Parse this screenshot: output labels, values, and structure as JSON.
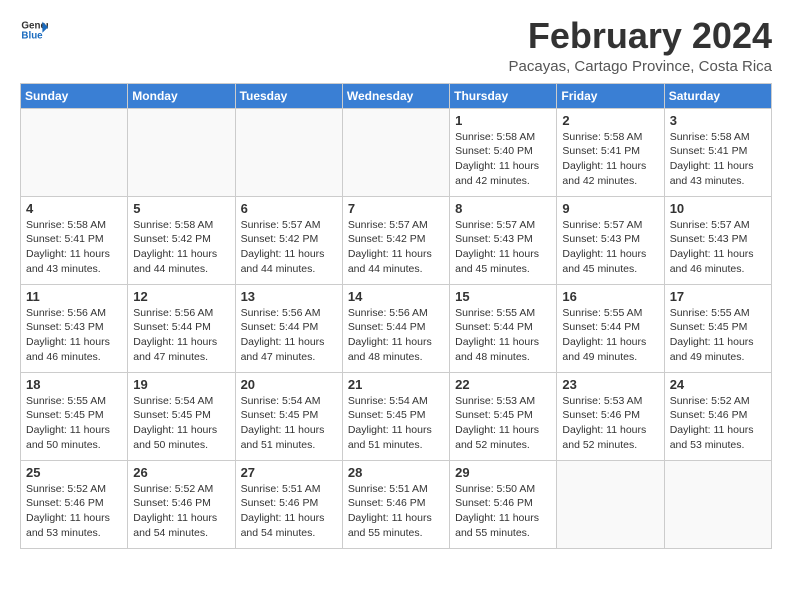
{
  "header": {
    "logo_line1": "General",
    "logo_line2": "Blue",
    "month_title": "February 2024",
    "subtitle": "Pacayas, Cartago Province, Costa Rica"
  },
  "days_of_week": [
    "Sunday",
    "Monday",
    "Tuesday",
    "Wednesday",
    "Thursday",
    "Friday",
    "Saturday"
  ],
  "weeks": [
    [
      {
        "day": "",
        "info": ""
      },
      {
        "day": "",
        "info": ""
      },
      {
        "day": "",
        "info": ""
      },
      {
        "day": "",
        "info": ""
      },
      {
        "day": "1",
        "info": "Sunrise: 5:58 AM\nSunset: 5:40 PM\nDaylight: 11 hours\nand 42 minutes."
      },
      {
        "day": "2",
        "info": "Sunrise: 5:58 AM\nSunset: 5:41 PM\nDaylight: 11 hours\nand 42 minutes."
      },
      {
        "day": "3",
        "info": "Sunrise: 5:58 AM\nSunset: 5:41 PM\nDaylight: 11 hours\nand 43 minutes."
      }
    ],
    [
      {
        "day": "4",
        "info": "Sunrise: 5:58 AM\nSunset: 5:41 PM\nDaylight: 11 hours\nand 43 minutes."
      },
      {
        "day": "5",
        "info": "Sunrise: 5:58 AM\nSunset: 5:42 PM\nDaylight: 11 hours\nand 44 minutes."
      },
      {
        "day": "6",
        "info": "Sunrise: 5:57 AM\nSunset: 5:42 PM\nDaylight: 11 hours\nand 44 minutes."
      },
      {
        "day": "7",
        "info": "Sunrise: 5:57 AM\nSunset: 5:42 PM\nDaylight: 11 hours\nand 44 minutes."
      },
      {
        "day": "8",
        "info": "Sunrise: 5:57 AM\nSunset: 5:43 PM\nDaylight: 11 hours\nand 45 minutes."
      },
      {
        "day": "9",
        "info": "Sunrise: 5:57 AM\nSunset: 5:43 PM\nDaylight: 11 hours\nand 45 minutes."
      },
      {
        "day": "10",
        "info": "Sunrise: 5:57 AM\nSunset: 5:43 PM\nDaylight: 11 hours\nand 46 minutes."
      }
    ],
    [
      {
        "day": "11",
        "info": "Sunrise: 5:56 AM\nSunset: 5:43 PM\nDaylight: 11 hours\nand 46 minutes."
      },
      {
        "day": "12",
        "info": "Sunrise: 5:56 AM\nSunset: 5:44 PM\nDaylight: 11 hours\nand 47 minutes."
      },
      {
        "day": "13",
        "info": "Sunrise: 5:56 AM\nSunset: 5:44 PM\nDaylight: 11 hours\nand 47 minutes."
      },
      {
        "day": "14",
        "info": "Sunrise: 5:56 AM\nSunset: 5:44 PM\nDaylight: 11 hours\nand 48 minutes."
      },
      {
        "day": "15",
        "info": "Sunrise: 5:55 AM\nSunset: 5:44 PM\nDaylight: 11 hours\nand 48 minutes."
      },
      {
        "day": "16",
        "info": "Sunrise: 5:55 AM\nSunset: 5:44 PM\nDaylight: 11 hours\nand 49 minutes."
      },
      {
        "day": "17",
        "info": "Sunrise: 5:55 AM\nSunset: 5:45 PM\nDaylight: 11 hours\nand 49 minutes."
      }
    ],
    [
      {
        "day": "18",
        "info": "Sunrise: 5:55 AM\nSunset: 5:45 PM\nDaylight: 11 hours\nand 50 minutes."
      },
      {
        "day": "19",
        "info": "Sunrise: 5:54 AM\nSunset: 5:45 PM\nDaylight: 11 hours\nand 50 minutes."
      },
      {
        "day": "20",
        "info": "Sunrise: 5:54 AM\nSunset: 5:45 PM\nDaylight: 11 hours\nand 51 minutes."
      },
      {
        "day": "21",
        "info": "Sunrise: 5:54 AM\nSunset: 5:45 PM\nDaylight: 11 hours\nand 51 minutes."
      },
      {
        "day": "22",
        "info": "Sunrise: 5:53 AM\nSunset: 5:45 PM\nDaylight: 11 hours\nand 52 minutes."
      },
      {
        "day": "23",
        "info": "Sunrise: 5:53 AM\nSunset: 5:46 PM\nDaylight: 11 hours\nand 52 minutes."
      },
      {
        "day": "24",
        "info": "Sunrise: 5:52 AM\nSunset: 5:46 PM\nDaylight: 11 hours\nand 53 minutes."
      }
    ],
    [
      {
        "day": "25",
        "info": "Sunrise: 5:52 AM\nSunset: 5:46 PM\nDaylight: 11 hours\nand 53 minutes."
      },
      {
        "day": "26",
        "info": "Sunrise: 5:52 AM\nSunset: 5:46 PM\nDaylight: 11 hours\nand 54 minutes."
      },
      {
        "day": "27",
        "info": "Sunrise: 5:51 AM\nSunset: 5:46 PM\nDaylight: 11 hours\nand 54 minutes."
      },
      {
        "day": "28",
        "info": "Sunrise: 5:51 AM\nSunset: 5:46 PM\nDaylight: 11 hours\nand 55 minutes."
      },
      {
        "day": "29",
        "info": "Sunrise: 5:50 AM\nSunset: 5:46 PM\nDaylight: 11 hours\nand 55 minutes."
      },
      {
        "day": "",
        "info": ""
      },
      {
        "day": "",
        "info": ""
      }
    ]
  ]
}
